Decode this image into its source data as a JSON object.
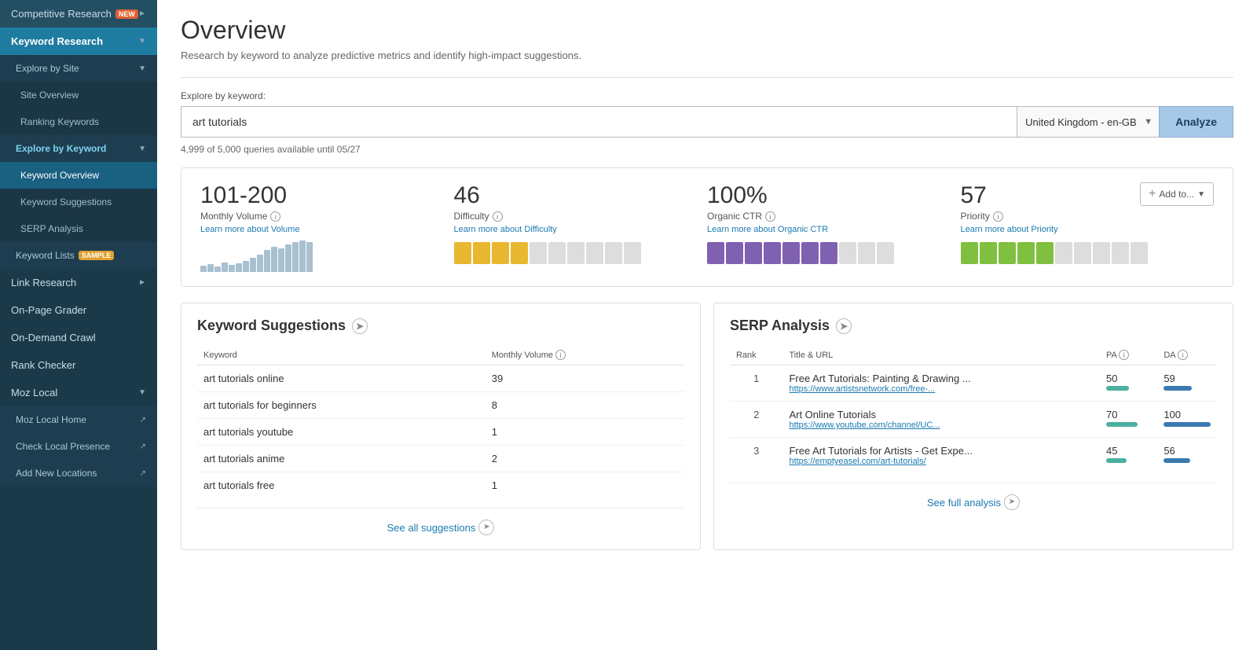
{
  "sidebar": {
    "items": [
      {
        "id": "competitive-research",
        "label": "Competitive Research",
        "badge": "NEW",
        "hasArrow": true,
        "depth": 0
      },
      {
        "id": "keyword-research",
        "label": "Keyword Research",
        "hasArrow": true,
        "depth": 0,
        "active": true
      },
      {
        "id": "explore-by-site",
        "label": "Explore by Site",
        "hasArrow": true,
        "depth": 1
      },
      {
        "id": "site-overview",
        "label": "Site Overview",
        "depth": 2
      },
      {
        "id": "ranking-keywords",
        "label": "Ranking Keywords",
        "depth": 2
      },
      {
        "id": "explore-by-keyword",
        "label": "Explore by Keyword",
        "hasArrow": true,
        "depth": 1
      },
      {
        "id": "keyword-overview",
        "label": "Keyword Overview",
        "depth": 2,
        "activeItem": true
      },
      {
        "id": "keyword-suggestions",
        "label": "Keyword Suggestions",
        "depth": 2
      },
      {
        "id": "serp-analysis",
        "label": "SERP Analysis",
        "depth": 2
      },
      {
        "id": "keyword-lists",
        "label": "Keyword Lists",
        "badge": "SAMPLE",
        "depth": 1
      },
      {
        "id": "link-research",
        "label": "Link Research",
        "hasArrow": true,
        "depth": 0
      },
      {
        "id": "on-page-grader",
        "label": "On-Page Grader",
        "depth": 0
      },
      {
        "id": "on-demand-crawl",
        "label": "On-Demand Crawl",
        "depth": 0
      },
      {
        "id": "rank-checker",
        "label": "Rank Checker",
        "depth": 0
      },
      {
        "id": "moz-local",
        "label": "Moz Local",
        "hasArrow": true,
        "depth": 0
      },
      {
        "id": "moz-local-home",
        "label": "Moz Local Home",
        "depth": 1,
        "external": true
      },
      {
        "id": "check-local-presence",
        "label": "Check Local Presence",
        "depth": 1,
        "external": true
      },
      {
        "id": "add-new-locations",
        "label": "Add New Locations",
        "depth": 1,
        "external": true
      }
    ]
  },
  "header": {
    "title": "Overview",
    "subtitle": "Research by keyword to analyze predictive metrics and identify high-impact suggestions."
  },
  "search": {
    "label": "Explore by keyword:",
    "value": "art tutorials",
    "locale_value": "United Kingdom - en-GB",
    "analyze_label": "Analyze",
    "queries_info": "4,999 of 5,000 queries available until 05/27"
  },
  "add_to_label": "Add to...",
  "metrics": {
    "monthly_volume": {
      "value": "101-200",
      "label": "Monthly Volume",
      "learn_more": "Learn more about Volume"
    },
    "difficulty": {
      "value": "46",
      "label": "Difficulty",
      "learn_more": "Learn more about Difficulty"
    },
    "organic_ctr": {
      "value": "100%",
      "label": "Organic CTR",
      "learn_more": "Learn more about Organic CTR"
    },
    "priority": {
      "value": "57",
      "label": "Priority",
      "learn_more": "Learn more about Priority"
    }
  },
  "keyword_suggestions": {
    "title": "Keyword Suggestions",
    "columns": [
      "Keyword",
      "Monthly Volume"
    ],
    "rows": [
      {
        "keyword": "art tutorials online",
        "volume": "39"
      },
      {
        "keyword": "art tutorials for beginners",
        "volume": "8"
      },
      {
        "keyword": "art tutorials youtube",
        "volume": "1"
      },
      {
        "keyword": "art tutorials anime",
        "volume": "2"
      },
      {
        "keyword": "art tutorials free",
        "volume": "1"
      }
    ],
    "see_all_label": "See all suggestions"
  },
  "serp_analysis": {
    "title": "SERP Analysis",
    "columns": [
      "Rank",
      "Title & URL",
      "PA",
      "DA"
    ],
    "rows": [
      {
        "rank": "1",
        "title": "Free Art Tutorials: Painting & Drawing ...",
        "url": "https://www.artistsnetwork.com/free-...",
        "pa": 50,
        "da": 59
      },
      {
        "rank": "2",
        "title": "Art Online Tutorials",
        "url": "https://www.youtube.com/channel/UC...",
        "pa": 70,
        "da": 100
      },
      {
        "rank": "3",
        "title": "Free Art Tutorials for Artists - Get Expe...",
        "url": "https://emptyeasel.com/art-tutorials/",
        "pa": 45,
        "da": 56
      }
    ],
    "see_full_label": "See full analysis"
  },
  "colors": {
    "difficulty_filled": "#e8b830",
    "difficulty_empty": "#ddd",
    "ctr_filled": "#8060b0",
    "ctr_empty": "#ddd",
    "priority_filled": "#80c040",
    "priority_empty": "#ddd",
    "pa_bar": "#4ab0a0",
    "da_bar": "#3a7ab0",
    "spark": "#a8c0d0"
  }
}
